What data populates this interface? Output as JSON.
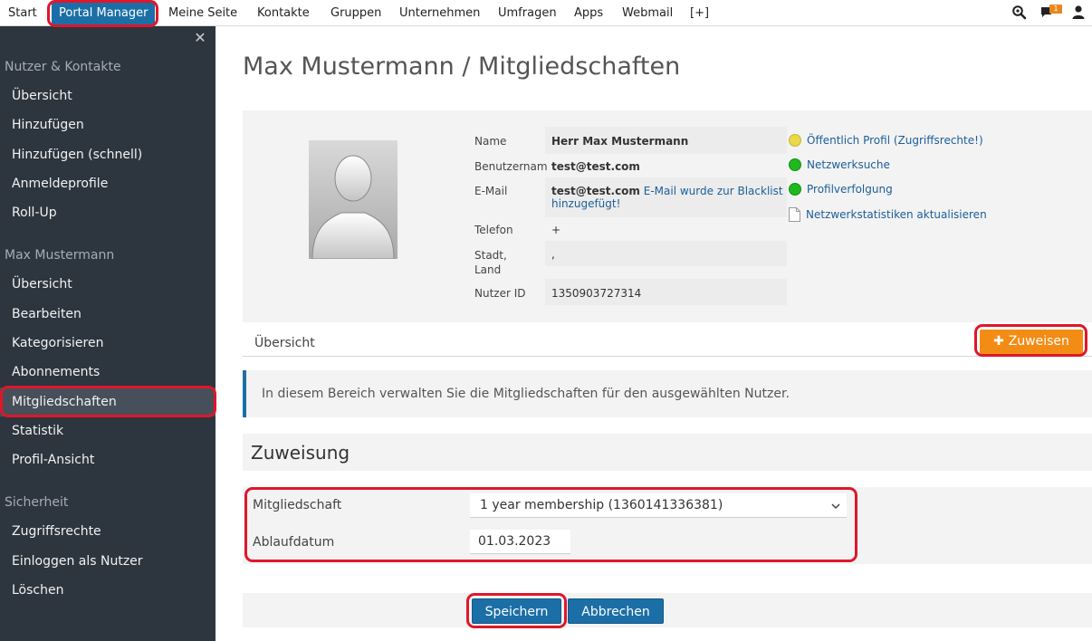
{
  "topnav": {
    "items": [
      "Start",
      "Portal Manager",
      "Meine Seite",
      "Kontakte",
      "Gruppen",
      "Unternehmen",
      "Umfragen",
      "Apps",
      "Webmail",
      "[+]"
    ],
    "notification_count": "1",
    "active_color": "#1b6fa6"
  },
  "sidebar": {
    "sections": [
      {
        "title": "Nutzer & Kontakte",
        "items": [
          "Übersicht",
          "Hinzufügen",
          "Hinzufügen (schnell)",
          "Anmeldeprofile",
          "Roll-Up"
        ]
      },
      {
        "title": "Max Mustermann",
        "items": [
          "Übersicht",
          "Bearbeiten",
          "Kategorisieren",
          "Abonnements",
          "Mitgliedschaften",
          "Statistik",
          "Profil-Ansicht"
        ]
      },
      {
        "title": "Sicherheit",
        "items": [
          "Zugriffsrechte",
          "Einloggen als Nutzer",
          "Löschen"
        ]
      }
    ],
    "active_item": "Mitgliedschaften"
  },
  "page": {
    "title": "Max Mustermann / Mitgliedschaften"
  },
  "profile": {
    "labels": {
      "name": "Name",
      "username": "Benutzernam",
      "email": "E-Mail",
      "phone": "Telefon",
      "city_line1": "Stadt,",
      "city_line2": "Land",
      "user_id": "Nutzer ID"
    },
    "values": {
      "name": "Herr Max Mustermann",
      "username": "test@test.com",
      "email": "test@test.com",
      "email_note_line1": "E-Mail wurde zur Blacklist",
      "email_note_line2": "hinzugefügt!",
      "phone": "+",
      "city": ",",
      "user_id": "1350903727314"
    },
    "status": {
      "public_profile": "Öffentlich Profil",
      "public_profile_paren_open": "(",
      "access_rights_link": "Zugriffsrechte!",
      "public_profile_paren_close": ")",
      "network_search": "Netzwerksuche",
      "profile_tracking": "Profilverfolgung",
      "update_stats": "Netzwerkstatistiken aktualisieren"
    }
  },
  "tabs": {
    "overview": "Übersicht",
    "assign_button": "Zuweisen"
  },
  "info_message": "In diesem Bereich verwalten Sie die Mitgliedschaften für den ausgewählten Nutzer.",
  "assignment": {
    "title": "Zuweisung",
    "membership_label": "Mitgliedschaft",
    "membership_value": "1 year membership (1360141336381)",
    "expiry_label": "Ablaufdatum",
    "expiry_value": "01.03.2023"
  },
  "actions": {
    "save": "Speichern",
    "cancel": "Abbrechen"
  }
}
